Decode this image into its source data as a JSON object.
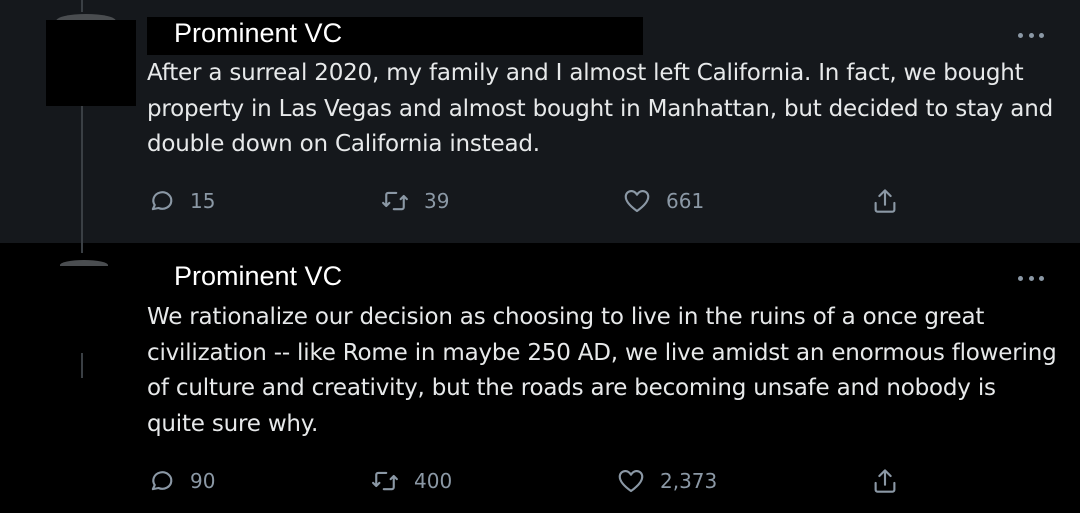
{
  "tweets": [
    {
      "author": "Prominent VC",
      "text": "After a surreal 2020, my family and I almost left California. In fact, we bought property in Las Vegas and almost bought in Manhattan, but decided to stay and double down on California instead.",
      "replies": "15",
      "retweets": "39",
      "likes": "661"
    },
    {
      "author": "Prominent VC",
      "text": "We rationalize our decision as choosing to live in the ruins of a once great civilization -- like Rome in maybe 250 AD, we live amidst an enormous flowering of culture and creativity, but the roads are becoming unsafe and nobody is quite sure why.",
      "replies": "90",
      "retweets": "400",
      "likes": "2,373"
    }
  ],
  "icons": {
    "reply": "reply-icon",
    "retweet": "retweet-icon",
    "like": "heart-icon",
    "share": "share-icon",
    "more": "more-icon"
  },
  "colors": {
    "background": "#000000",
    "highlight_background": "#15181c",
    "text": "#e7e9ea",
    "muted": "#8b98a5"
  }
}
